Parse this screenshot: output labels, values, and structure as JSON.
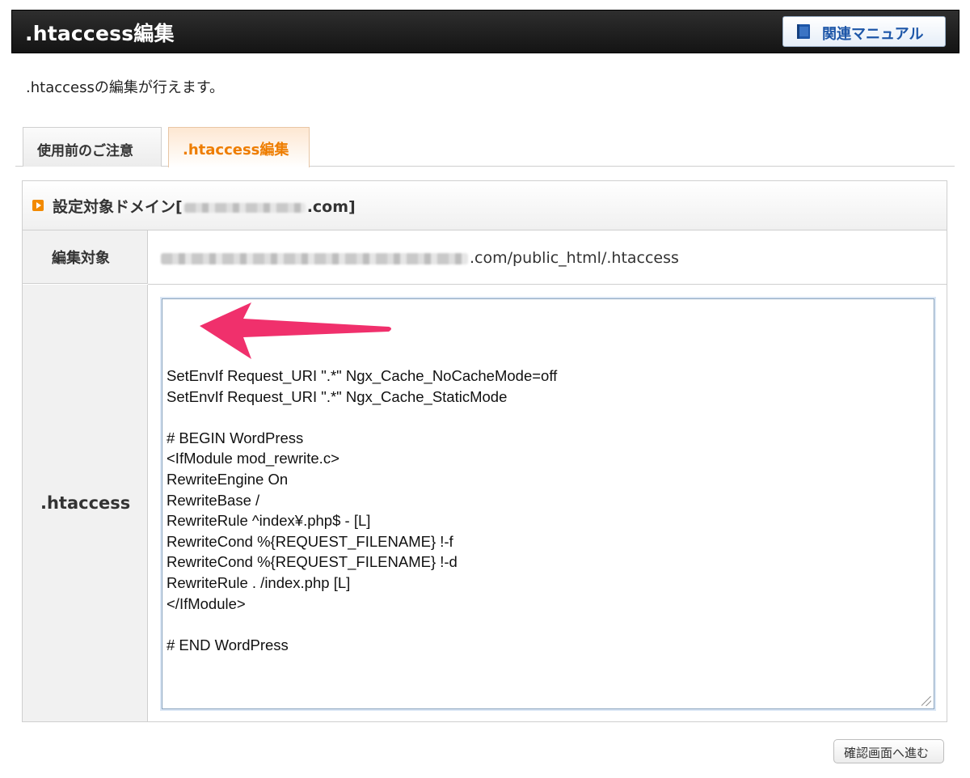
{
  "header": {
    "title": ".htaccess編集",
    "manual_button": "関連マニュアル",
    "manual_icon": "book-icon"
  },
  "intro_text": ".htaccessの編集が行えます。",
  "tabs": [
    {
      "label": "使用前のご注意",
      "active": false
    },
    {
      "label": ".htaccess編集",
      "active": true
    }
  ],
  "panel": {
    "heading_prefix": "設定対象ドメイン[",
    "heading_suffix": ".com]",
    "rows": [
      {
        "label": "編集対象",
        "value_suffix": ".com/public_html/.htaccess"
      },
      {
        "label": ".htaccess"
      }
    ]
  },
  "editor": {
    "content": "SetEnvIf Request_URI \".*\" Ngx_Cache_NoCacheMode=off\nSetEnvIf Request_URI \".*\" Ngx_Cache_StaticMode\n\n# BEGIN WordPress\n<IfModule mod_rewrite.c>\nRewriteEngine On\nRewriteBase /\nRewriteRule ^index¥.php$ - [L]\nRewriteCond %{REQUEST_FILENAME} !-f\nRewriteCond %{REQUEST_FILENAME} !-d\nRewriteRule . /index.php [L]\n</IfModule>\n\n# END WordPress"
  },
  "confirm_button": "確認画面へ進む",
  "colors": {
    "header_bg": "#1c1c1c",
    "active_tab_text": "#ee7d00",
    "manual_text": "#1d56a8",
    "arrow": "#f0306c"
  }
}
